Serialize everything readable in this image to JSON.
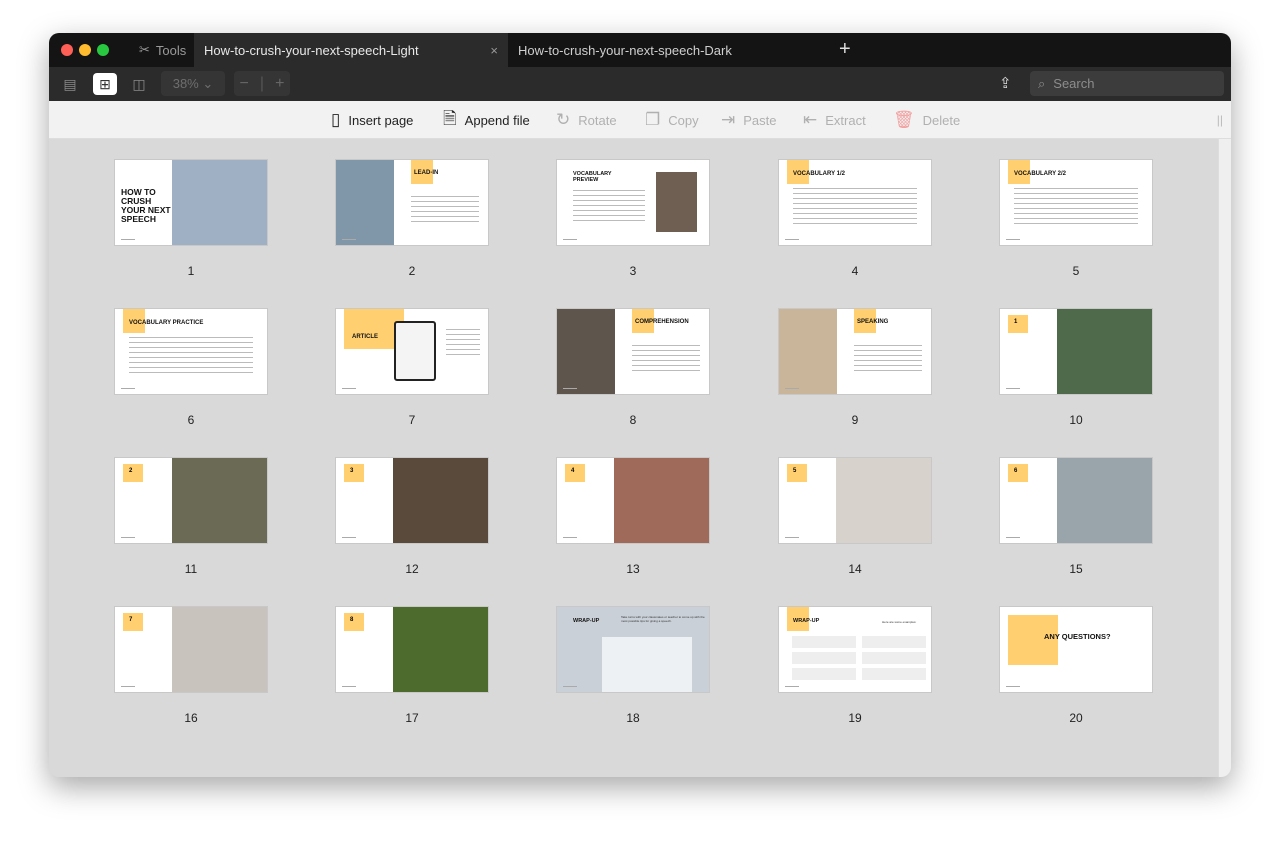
{
  "window": {
    "tools_label": "Tools",
    "tabs": [
      {
        "label": "How-to-crush-your-next-speech-Light",
        "active": true
      },
      {
        "label": "How-to-crush-your-next-speech-Dark",
        "active": false
      }
    ],
    "close_glyph": "×",
    "new_tab_glyph": "+"
  },
  "toolbar": {
    "zoom": "38%",
    "search_placeholder": "Search",
    "view_modes": [
      "sidebar-view",
      "grid-view",
      "two-page-view"
    ],
    "active_view": "grid-view"
  },
  "actions": [
    {
      "label": "Insert page",
      "icon": "insert-page-icon",
      "enabled": true
    },
    {
      "label": "Append file",
      "icon": "pdf-file-icon",
      "enabled": true
    },
    {
      "label": "Rotate",
      "icon": "rotate-icon",
      "enabled": false
    },
    {
      "label": "Copy",
      "icon": "copy-icon",
      "enabled": false
    },
    {
      "label": "Paste",
      "icon": "paste-icon",
      "enabled": false
    },
    {
      "label": "Extract",
      "icon": "extract-icon",
      "enabled": false
    },
    {
      "label": "Delete",
      "icon": "trash-icon",
      "enabled": false
    }
  ],
  "colors": {
    "accent_yellow": "#ffcf70",
    "delete": "#f2a0a0"
  },
  "pages": [
    {
      "number": "1",
      "title": "HOW TO CRUSH YOUR NEXT SPEECH",
      "layout": "cover",
      "photo": "#9fb0c4"
    },
    {
      "number": "2",
      "title": "LEAD-IN",
      "layout": "left-photo",
      "photo": "#7f97a8",
      "text": "Pick 3 aspects of public speaking that you find most challenging and explain."
    },
    {
      "number": "3",
      "title": "VOCABULARY PREVIEW",
      "layout": "vocab",
      "photo": "#6e5f52"
    },
    {
      "number": "4",
      "title": "VOCABULARY 1/2",
      "layout": "text"
    },
    {
      "number": "5",
      "title": "VOCABULARY 2/2",
      "layout": "text"
    },
    {
      "number": "6",
      "title": "VOCABULARY PRACTICE",
      "layout": "text"
    },
    {
      "number": "7",
      "title": "ARTICLE",
      "layout": "article",
      "photo": "#222"
    },
    {
      "number": "8",
      "title": "COMPREHENSION",
      "layout": "left-photo",
      "photo": "#5e564c"
    },
    {
      "number": "9",
      "title": "SPEAKING",
      "layout": "left-photo",
      "photo": "#c9b59a"
    },
    {
      "number": "10",
      "badge": "1",
      "layout": "numbered",
      "photo": "#4f6a4a"
    },
    {
      "number": "11",
      "badge": "2",
      "layout": "numbered",
      "photo": "#6b6a55"
    },
    {
      "number": "12",
      "badge": "3",
      "layout": "numbered",
      "photo": "#5a4a3c"
    },
    {
      "number": "13",
      "badge": "4",
      "layout": "numbered",
      "photo": "#a06a5a"
    },
    {
      "number": "14",
      "badge": "5",
      "layout": "numbered",
      "photo": "#d8d2cc"
    },
    {
      "number": "15",
      "badge": "6",
      "layout": "numbered",
      "photo": "#9aa4ab"
    },
    {
      "number": "16",
      "badge": "7",
      "layout": "numbered",
      "photo": "#c8c4bd"
    },
    {
      "number": "17",
      "badge": "8",
      "layout": "numbered",
      "photo": "#4e6b2e"
    },
    {
      "number": "18",
      "title": "WRAP-UP",
      "layout": "wrap-photo",
      "photo": "#c9d0d8",
      "text": "Take turns with your classmates or teacher to come up with the most possible tips for giving a speech."
    },
    {
      "number": "19",
      "title": "WRAP-UP",
      "layout": "wrap-text",
      "text": "Here are some examples:"
    },
    {
      "number": "20",
      "title": "ANY QUESTIONS?",
      "layout": "final"
    }
  ]
}
